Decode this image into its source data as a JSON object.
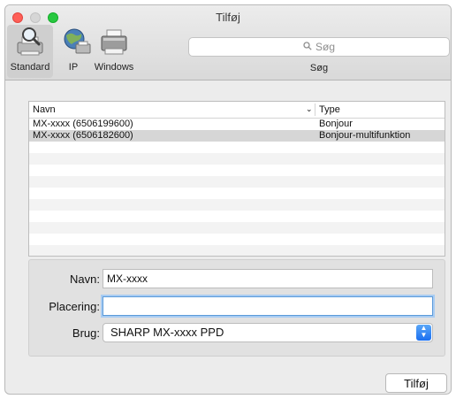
{
  "window": {
    "title": "Tilføj"
  },
  "toolbar": {
    "items": [
      {
        "label": "Standard",
        "icon": "default-printer-icon"
      },
      {
        "label": "IP",
        "icon": "globe-icon"
      },
      {
        "label": "Windows",
        "icon": "windows-printer-icon"
      }
    ],
    "search": {
      "placeholder": "Søg",
      "caption": "Søg"
    }
  },
  "list": {
    "columns": [
      "Navn",
      "Type"
    ],
    "rows": [
      {
        "name": "MX-xxxx (6506199600)",
        "type": "Bonjour"
      },
      {
        "name": "MX-xxxx (6506182600)",
        "type": "Bonjour-multifunktion"
      }
    ],
    "selected_index": 1
  },
  "details": {
    "name_label": "Navn:",
    "name_value": "MX-xxxx",
    "location_label": "Placering:",
    "location_value": "",
    "use_label": "Brug:",
    "use_value": "SHARP MX-xxxx PPD"
  },
  "actions": {
    "add_label": "Tilføj"
  },
  "colors": {
    "close": "#ff5f57",
    "maximize": "#28c840",
    "accent": "#1b6ff0",
    "focus_ring": "#a9ccf2"
  }
}
